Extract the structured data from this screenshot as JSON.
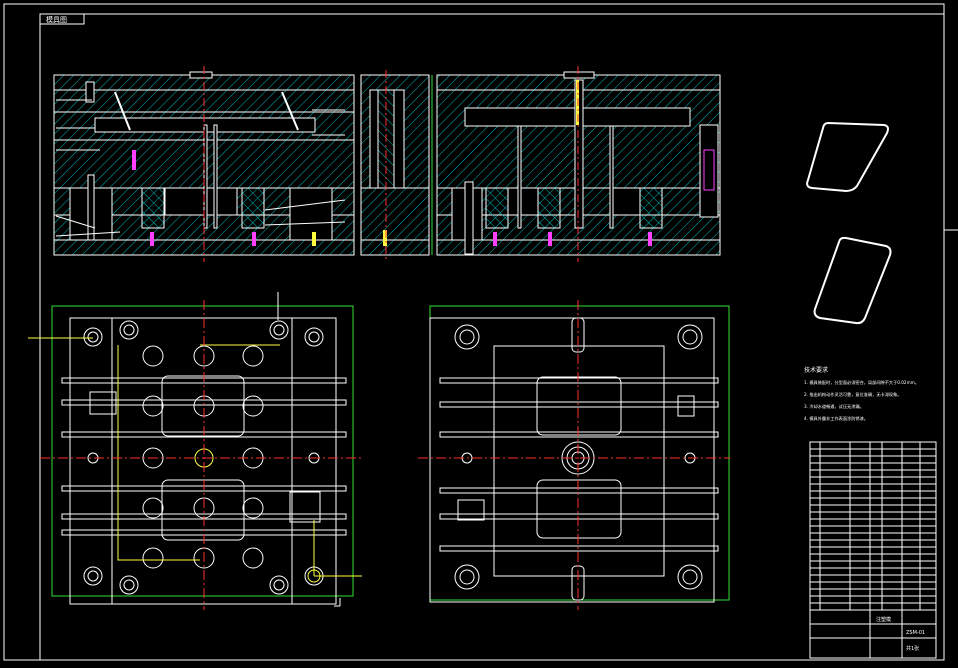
{
  "title_tag": "模具图",
  "notes": {
    "heading": "技术要求",
    "lines": [
      "1. 模具装配时，分型面必须密合，局部间隙不大于0.02mm。",
      "2. 推出机构动作灵活可靠，复位准确，无卡滞现象。",
      "3. 冷却水道畅通，试压无渗漏。",
      "4. 模具外露非工作表面涂防锈漆。"
    ]
  },
  "title_block": {
    "drawing_name": "注塑模",
    "drawing_no": "ZSM-01",
    "sheet": "共1张"
  },
  "colors": {
    "background": "#000000",
    "outline": "#ffffff",
    "hatch": "#00c8c8",
    "centerline": "#ff3030",
    "ejector": "#ff40ff",
    "leader": "#ffff40",
    "frame_green": "#30e030"
  }
}
